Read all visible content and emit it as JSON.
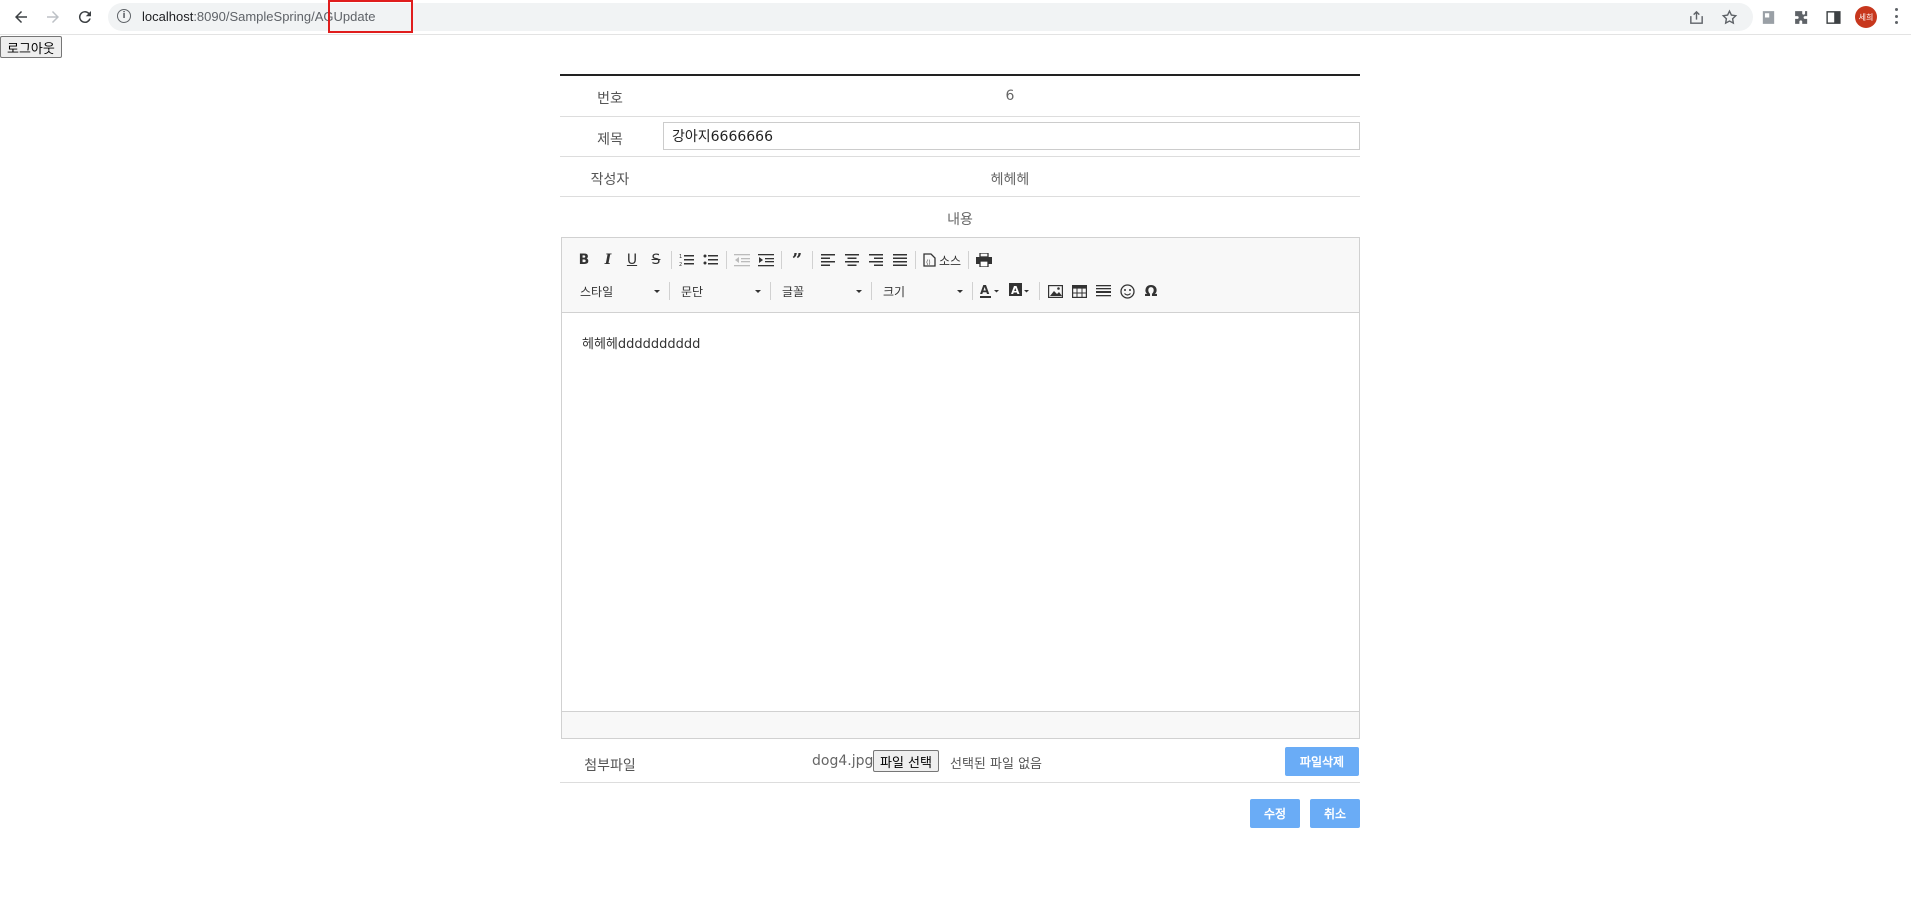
{
  "browser": {
    "url_host": "localhost",
    "url_path": ":8090/SampleSpring/AGUpdate",
    "profile_initials": "세희"
  },
  "page": {
    "logout_label": "로그아웃"
  },
  "form": {
    "number_label": "번호",
    "number_value": "6",
    "title_label": "제목",
    "title_value": "강아지6666666",
    "writer_label": "작성자",
    "writer_value": "헤헤헤",
    "content_label": "내용"
  },
  "editor": {
    "toolbar": {
      "source_label": "소스",
      "style_label": "스타일",
      "format_label": "문단",
      "font_label": "글꼴",
      "size_label": "크기"
    },
    "content_text": "헤헤헤dddddddddd"
  },
  "attachment": {
    "label": "첨부파일",
    "current_file": "dog4.jpg",
    "choose_button": "파일 선택",
    "no_file_text": "선택된 파일 없음",
    "delete_button": "파일삭제"
  },
  "actions": {
    "submit_label": "수정",
    "cancel_label": "취소"
  },
  "colors": {
    "accent_button": "#6aacf6",
    "highlight_box": "#e01d1d"
  }
}
